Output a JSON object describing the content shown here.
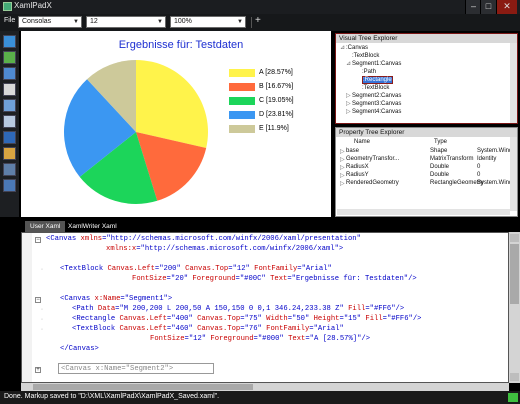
{
  "window": {
    "title": "XamlPadX",
    "minimize": "–",
    "maximize": "□",
    "close": "✕"
  },
  "toolbar": {
    "menu_file": "File",
    "font_family": "Consolas",
    "font_size": "12",
    "zoom": "100%",
    "add": "+"
  },
  "chart_data": {
    "type": "pie",
    "title": "Ergebnisse für: Testdaten",
    "categories": [
      "A [28.57%]",
      "B [16.67%]",
      "C [19.05%]",
      "D [23.81%]",
      "E [11.9%]"
    ],
    "values": [
      28.57,
      16.67,
      19.05,
      23.81,
      11.9
    ],
    "colors": [
      "#FFF34B",
      "#FF6A3C",
      "#1CD55A",
      "#3B97F2",
      "#CDC99A"
    ],
    "legend": "right"
  },
  "visual_tree": {
    "title": "Visual Tree Explorer",
    "nodes": [
      ":Canvas",
      ":TextBlock",
      "Segment1:Canvas",
      ":Path",
      ":Rectangle",
      ":TextBlock",
      "Segment2:Canvas",
      "Segment3:Canvas",
      "Segment4:Canvas"
    ],
    "selected": ":Rectangle"
  },
  "property_tree": {
    "title": "Property Tree Explorer",
    "headers": [
      "Name",
      "Type",
      ""
    ],
    "rows": [
      [
        "base",
        "Shape",
        "System.Wind"
      ],
      [
        "GeometryTransfor...",
        "MatrixTransform",
        "Identity"
      ],
      [
        "RadiusX",
        "Double",
        "0"
      ],
      [
        "RadiusY",
        "Double",
        "0"
      ],
      [
        "RenderedGeometry",
        "RectangleGeometry",
        "System.Wind"
      ]
    ]
  },
  "tabs": [
    "User Xaml",
    "XamlWriter Xaml"
  ],
  "code": {
    "l1a": "<Canvas ",
    "l1b": "xmlns",
    "l1c": "=\"http://schemas.microsoft.com/winfx/2006/xaml/presentation\"",
    "l2b": "xmlns:x",
    "l2c": "=\"http://schemas.microsoft.com/winfx/2006/xaml\">",
    "l3a": "<TextBlock ",
    "l3b": "Canvas.Left",
    "l3c": "=\"200\" ",
    "l3d": "Canvas.Top",
    "l3e": "=\"12\" ",
    "l3f": "FontFamily",
    "l3g": "=\"Arial\"",
    "l4b": "FontSize",
    "l4c": "=\"20\" ",
    "l4d": "Foreground",
    "l4e": "=\"#00C\" ",
    "l4f": "Text",
    "l4g": "=\"Ergebnisse für: Testdaten\"/>",
    "l5a": "<Canvas ",
    "l5b": "x:Name",
    "l5c": "=\"Segment1\">",
    "l6a": "<Path ",
    "l6b": "Data",
    "l6c": "=\"M 200,200 L 200,50 A 150,150 0 0,1 346.24,233.38 Z\" ",
    "l6d": "Fill",
    "l6e": "=\"#FF6\"/>",
    "l7a": "<Rectangle ",
    "l7b": "Canvas.Left",
    "l7c": "=\"400\" ",
    "l7d": "Canvas.Top",
    "l7e": "=\"75\" ",
    "l7f": "Width",
    "l7g": "=\"50\" ",
    "l7h": "Height",
    "l7i": "=\"15\" ",
    "l7j": "Fill",
    "l7k": "=\"#FF6\"/>",
    "l8a": "<TextBlock ",
    "l8b": "Canvas.Left",
    "l8c": "=\"460\" ",
    "l8d": "Canvas.Top",
    "l8e": "=\"76\" ",
    "l8f": "FontFamily",
    "l8g": "=\"Arial\"",
    "l9b": "FontSize",
    "l9c": "=\"12\" ",
    "l9d": "Foreground",
    "l9e": "=\"#000\" ",
    "l9f": "Text",
    "l9g": "=\"A [28.57%]\"/>",
    "l10a": "</Canvas>",
    "l11a": "<Canvas x:Name=\"Segment2\">"
  },
  "status": "Done. Markup saved to \"D:\\XML\\XamlPadX\\XamlPadX_Saved.xaml\"."
}
